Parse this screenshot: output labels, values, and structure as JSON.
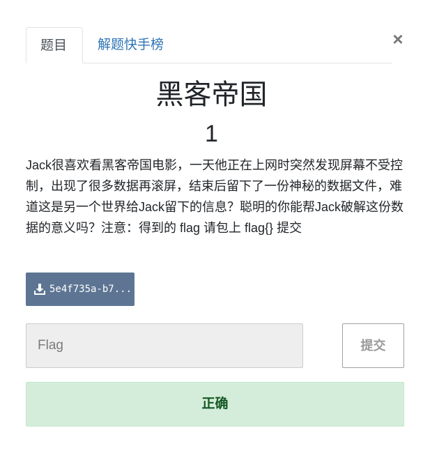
{
  "modal": {
    "close_symbol": "×"
  },
  "tabs": [
    {
      "label": "题目",
      "active": true
    },
    {
      "label": "解题快手榜",
      "active": false
    }
  ],
  "challenge": {
    "name": "黑客帝国",
    "points": "1",
    "description": "Jack很喜欢看黑客帝国电影，一天他正在上网时突然发现屏幕不受控制，出现了很多数据再滚屏，结束后留下了一份神秘的数据文件，难道这是另一个世界给Jack留下的信息？聪明的你能帮Jack破解这份数据的意义吗？注意：得到的 flag 请包上 flag{} 提交"
  },
  "file": {
    "name": "5e4f735a-b7...",
    "icon": "download-icon"
  },
  "form": {
    "flag_placeholder": "Flag",
    "flag_value": "",
    "submit_label": "提交"
  },
  "result": {
    "message": "正确"
  },
  "colors": {
    "tab_link": "#2e74b5",
    "file_button": "#5d7593",
    "success_bg": "#d4edda",
    "success_text": "#155724"
  }
}
